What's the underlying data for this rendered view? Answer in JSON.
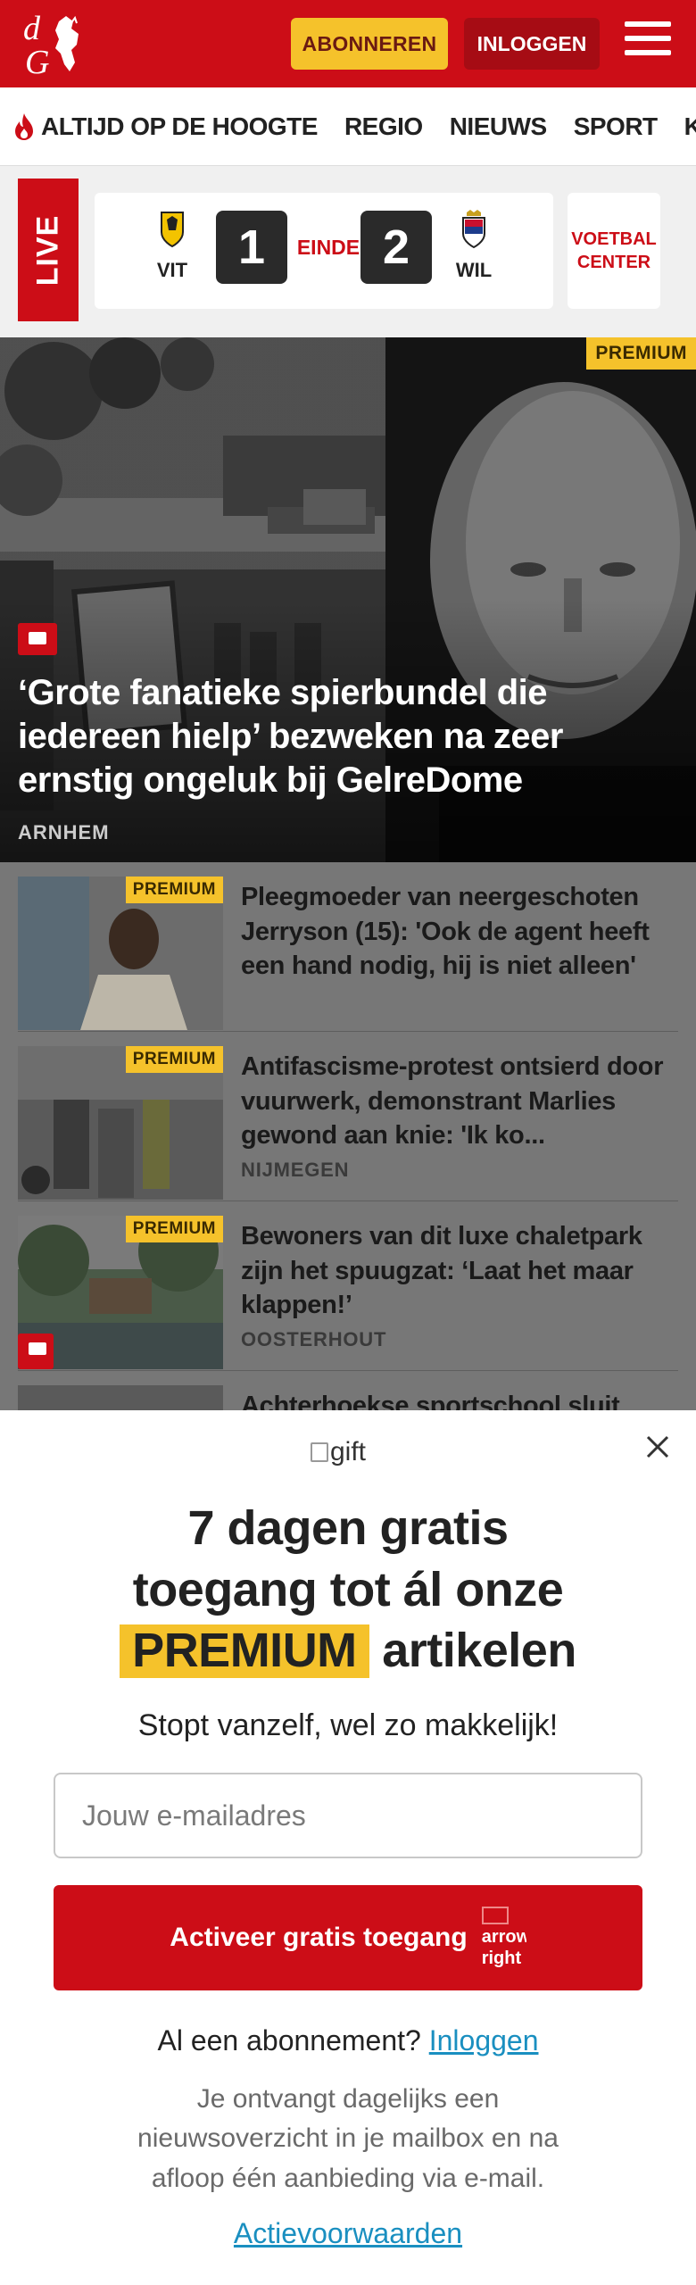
{
  "header": {
    "logo_text": "dG",
    "subscribe_label": "ABONNEREN",
    "login_label": "INLOGGEN"
  },
  "nav": {
    "items": [
      "ALTIJD OP DE HOOGTE",
      "REGIO",
      "NIEUWS",
      "SPORT",
      "KIJK"
    ]
  },
  "scoreboard": {
    "live_label": "LIVE",
    "home_team": "VIT",
    "home_score": "1",
    "status": "EINDE",
    "away_score": "2",
    "away_team": "WIL",
    "voetbal_center_line1": "VOETBAL",
    "voetbal_center_line2": "CENTER"
  },
  "hero": {
    "badge": "PREMIUM",
    "title": "‘Grote fanatieke spierbundel die iedereen hielp’ bezweken na zeer ernstig ongeluk bij GelreDome",
    "location": "ARNHEM"
  },
  "articles": [
    {
      "badge": "PREMIUM",
      "title": "Pleegmoeder van neergeschoten Jerryson (15): 'Ook de agent heeft een hand nodig, hij is niet alleen'",
      "location": ""
    },
    {
      "badge": "PREMIUM",
      "title": "Antifascisme-protest ontsierd door vuurwerk, demonstrant Marlies gewond aan knie: 'Ik ko...",
      "location": "NIJMEGEN"
    },
    {
      "badge": "PREMIUM",
      "title": "Bewoners van dit luxe chaletpark zijn het spuugzat: ‘Laat het maar klappen!’",
      "location": "OOSTERHOUT"
    },
    {
      "title": "Achterhoekse sportschool sluit"
    }
  ],
  "modal": {
    "gift_alt": "gift",
    "title_line1": "7 dagen gratis",
    "title_line2": "toegang tot ál onze",
    "title_highlight": "PREMIUM",
    "title_line3_rest": "artikelen",
    "subtitle": "Stopt vanzelf, wel zo makkelijk!",
    "email_placeholder": "Jouw e-mailadres",
    "cta_label": "Activeer gratis toegang",
    "cta_icon_alt": "arrow-right",
    "login_prompt": "Al een abonnement?",
    "login_link": "Inloggen",
    "info_text": "Je ontvangt dagelijks een nieuwsoverzicht in je mailbox en na afloop één aanbieding via e-mail.",
    "terms_link": "Actievoorwaarden"
  },
  "colors": {
    "brand_red": "#cc0d17",
    "premium_yellow": "#f5c22b",
    "link_blue": "#1a8fc0"
  }
}
